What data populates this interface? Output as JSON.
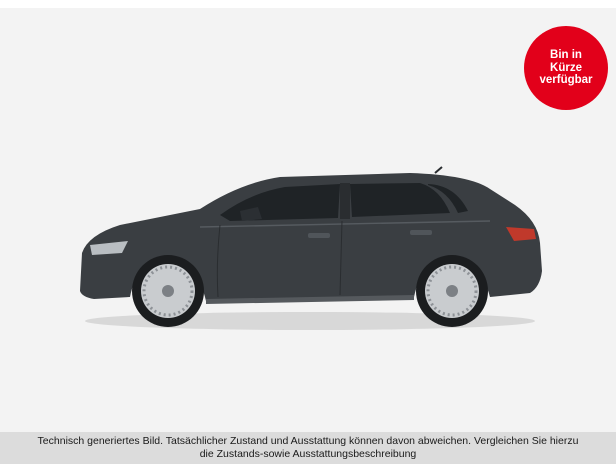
{
  "badge": {
    "line1": "Bin in",
    "line2": "Kürze",
    "line3": "verfügbar",
    "color": "#e2001a"
  },
  "vehicle_image": {
    "icon": "car-image",
    "body_color": "#3a3e42"
  },
  "disclaimer": {
    "line1": "Technisch generiertes Bild. Tatsächlicher Zustand und Ausstattung können davon abweichen. Vergleichen Sie hierzu",
    "line2": "die Zustands-sowie Ausstattungsbeschreibung"
  }
}
